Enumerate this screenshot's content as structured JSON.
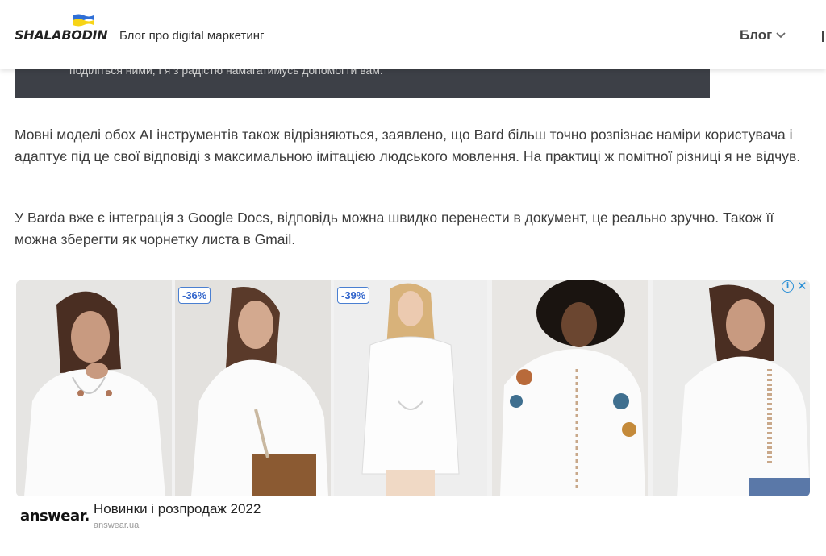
{
  "header": {
    "logo_text": "SHALABODIN",
    "tagline": "Блог про digital маркетинг",
    "nav_blog_label": "Блог"
  },
  "callout": {
    "text": "поділіться ними, і я з радістю намагатимусь допомогти вам."
  },
  "article": {
    "paragraph_1": "Мовні моделі обох AI інструментів також відрізняються, заявлено, що Bard більш точно розпізнає наміри користувача і адаптує під це свої відповіді з максимальною імітацією людського мовлення. На практиці ж помітної різниці я не відчув.",
    "paragraph_2": "У Barda вже є інтеграція з Google Docs, відповідь можна швидко перенести в документ, це реально зручно. Також її можна зберегти як чорнетку листа в Gmail."
  },
  "ad": {
    "products": [
      {
        "icon": "blouse-photo",
        "discount": ""
      },
      {
        "icon": "blouse-photo",
        "discount": "-36%"
      },
      {
        "icon": "shirt-photo",
        "discount": "-39%"
      },
      {
        "icon": "embroidered-blouse-photo",
        "discount": ""
      },
      {
        "icon": "lace-blouse-photo",
        "discount": ""
      }
    ],
    "brand_logo_text": "answear.",
    "title": "Новинки і розпродаж 2022",
    "domain": "answear.ua",
    "info_icon": "i",
    "close_icon": "✕"
  },
  "colors": {
    "callout_bg": "#3d4047",
    "accent_blue": "#2a8fd6",
    "flag_blue": "#2f6fd6",
    "flag_yellow": "#f7d417"
  }
}
